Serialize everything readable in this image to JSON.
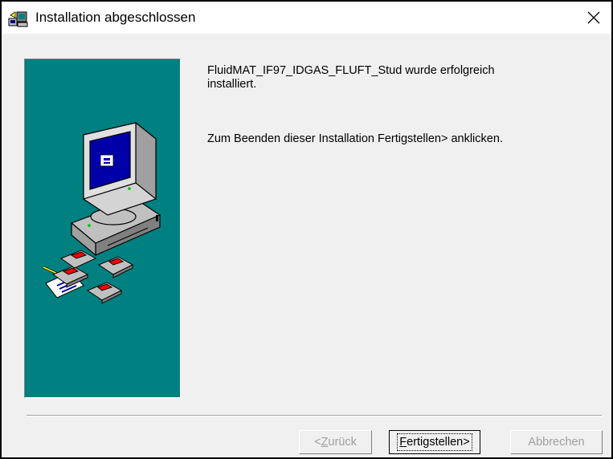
{
  "window": {
    "title": "Installation abgeschlossen",
    "title_icon": "setup-icon",
    "close_icon": "close-icon"
  },
  "content": {
    "message_line1": "FluidMAT_IF97_IDGAS_FLUFT_Stud wurde erfolgreich",
    "message_line2": "installiert.",
    "message_finish": "Zum Beenden dieser Installation Fertigstellen> anklicken."
  },
  "buttons": {
    "back": {
      "mnemonic": "Z",
      "rest": "urück",
      "prefix": "<",
      "enabled": false
    },
    "finish": {
      "mnemonic": "F",
      "rest": "ertigstellen>",
      "enabled": true,
      "default": true
    },
    "cancel": {
      "label": "Abbrechen",
      "enabled": false
    }
  },
  "colors": {
    "panel": "#008080",
    "dialog_bg": "#f0f0f0",
    "disabled_text": "#a0a0a0"
  }
}
